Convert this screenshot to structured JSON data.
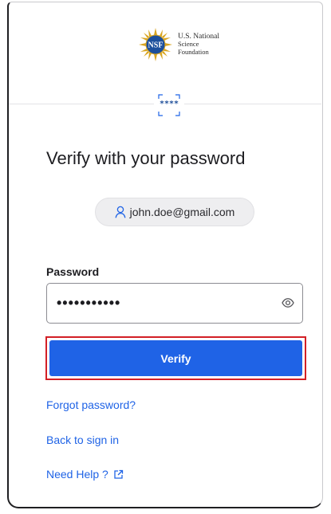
{
  "logo": {
    "line1": "U.S. National",
    "line2": "Science",
    "line3": "Foundation",
    "emblem_text": "NSF"
  },
  "auth_icon": {
    "stars": "****",
    "icon": "password-authenticator-icon"
  },
  "title": "Verify with your password",
  "user": {
    "email": "john.doe@gmail.com",
    "icon": "person-icon"
  },
  "password": {
    "label": "Password",
    "masked_value": "•••••••••••",
    "toggle_icon": "eye-icon"
  },
  "verify_button": {
    "label": "Verify"
  },
  "links": {
    "forgot": "Forgot password?",
    "back": "Back to sign in",
    "help": "Need Help ?",
    "help_icon": "external-link-icon"
  },
  "colors": {
    "accent": "#1f63e6",
    "highlight": "#d31f26",
    "chip_bg": "#eeeef0"
  }
}
